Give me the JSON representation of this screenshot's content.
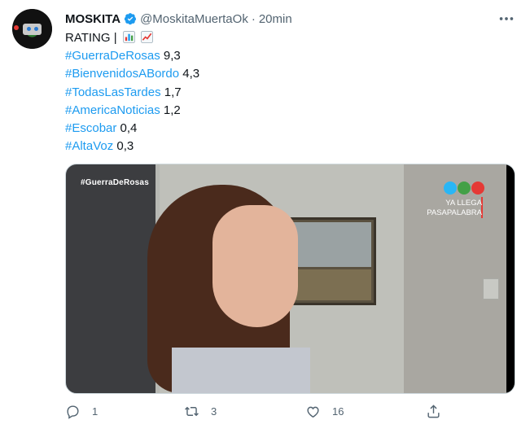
{
  "tweet": {
    "display_name": "MOSKITA",
    "handle": "@MoskitaMuertaOk",
    "separator": "·",
    "time": "20min",
    "first_line": "RATING |",
    "ratings": [
      {
        "hashtag": "#GuerraDeRosas",
        "value": "9,3"
      },
      {
        "hashtag": "#BienvenidosABordo",
        "value": "4,3"
      },
      {
        "hashtag": "#TodasLasTardes",
        "value": "1,7"
      },
      {
        "hashtag": "#AmericaNoticias",
        "value": "1,2"
      },
      {
        "hashtag": "#Escobar",
        "value": "0,4"
      },
      {
        "hashtag": "#AltaVoz",
        "value": "0,3"
      }
    ]
  },
  "media": {
    "overlay_hashtag": "#GuerraDeRosas",
    "promo_line1": "YA LLEGA",
    "promo_line2": "PASAPALABRA"
  },
  "actions": {
    "reply_count": "1",
    "retweet_count": "3",
    "like_count": "16"
  },
  "colors": {
    "link": "#1d9bf0",
    "muted": "#536471",
    "verified": "#1d9bf0"
  },
  "icons": [
    "verified-badge-icon",
    "more-options-icon",
    "bar-chart-emoji",
    "chart-increasing-emoji",
    "reply-icon",
    "retweet-icon",
    "like-icon",
    "share-icon"
  ]
}
